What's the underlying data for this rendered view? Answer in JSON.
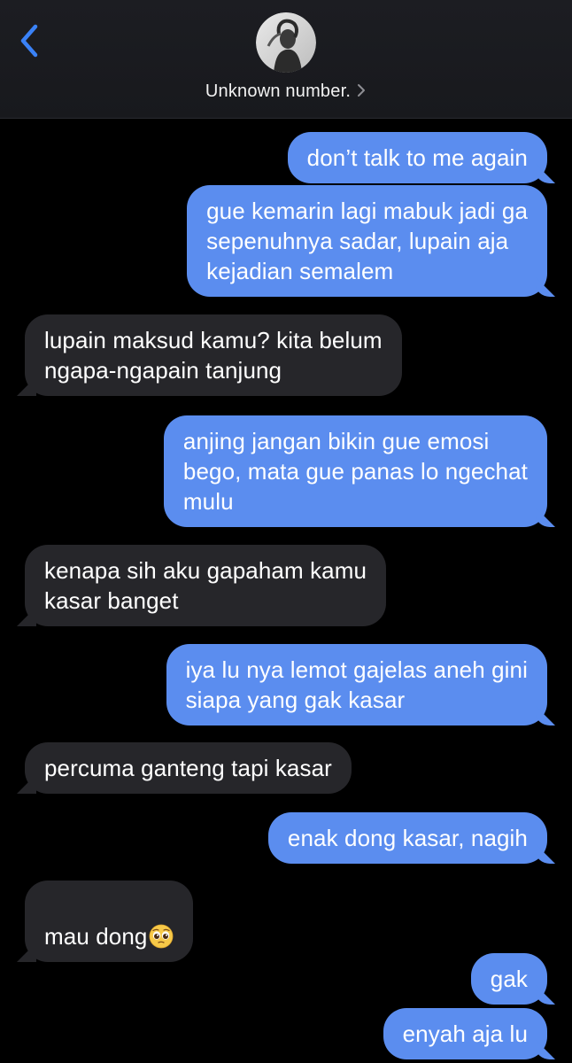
{
  "header": {
    "back_icon": "chevron-left-icon",
    "contact_name": "Unknown number.",
    "chevron_icon": "chevron-right-icon",
    "colors": {
      "background": "#1c1d22",
      "accent": "#3a82f7"
    }
  },
  "messages": [
    {
      "direction": "outgoing",
      "text": "don’t talk to me again"
    },
    {
      "direction": "outgoing",
      "text": "gue kemarin lagi mabuk jadi ga\nsepenuhnya sadar, lupain aja\nkejadian semalem"
    },
    {
      "direction": "incoming",
      "text": "lupain maksud kamu? kita belum\nngapa-ngapain tanjung"
    },
    {
      "direction": "outgoing",
      "text": "anjing jangan bikin gue emosi\nbego, mata gue panas lo ngechat\nmulu"
    },
    {
      "direction": "incoming",
      "text": "kenapa sih aku gapaham kamu\nkasar banget"
    },
    {
      "direction": "outgoing",
      "text": "iya lu nya lemot gajelas aneh gini\nsiapa yang gak kasar"
    },
    {
      "direction": "incoming",
      "text": "percuma ganteng tapi kasar"
    },
    {
      "direction": "outgoing",
      "text": "enak dong kasar, nagih"
    },
    {
      "direction": "incoming",
      "text": "mau dong",
      "emoji": "pleading-face-emoji"
    },
    {
      "direction": "outgoing",
      "text": "gak"
    },
    {
      "direction": "outgoing",
      "text": "enyah aja lu"
    }
  ],
  "colors": {
    "outgoing_bubble": "#5b8def",
    "incoming_bubble": "#26262a",
    "thread_background": "#000000"
  }
}
